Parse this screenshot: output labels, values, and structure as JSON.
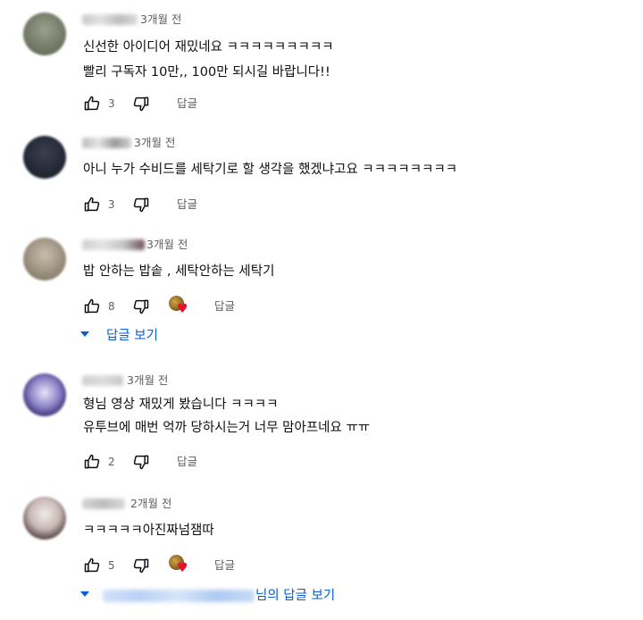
{
  "comments": [
    {
      "time": "3개월 전",
      "lines": [
        "신선한 아이디어 재밌네요 ㅋㅋㅋㅋㅋㅋㅋㅋㅋ",
        "빨리 구독자 10만,, 100만 되시길 바랍니다!!"
      ],
      "likes": "3",
      "reply": "답글"
    },
    {
      "time": "3개월 전",
      "lines": [
        "아니 누가 수비드를 세탁기로 할 생각을 했겠냐고요 ㅋㅋㅋㅋㅋㅋㅋㅋ"
      ],
      "likes": "3",
      "reply": "답글"
    },
    {
      "time": "3개월 전",
      "lines": [
        "밥 안하는 밥솥 , 세탁안하는 세탁기"
      ],
      "likes": "8",
      "reply": "답글",
      "view_replies": "답글 보기"
    },
    {
      "time": "3개월 전",
      "lines": [
        "형님 영상 재밌게 봤습니다 ㅋㅋㅋㅋ",
        "유투브에 매번 억까 당하시는거 너무 맘아프네요 ㅠㅠ"
      ],
      "likes": "2",
      "reply": "답글"
    },
    {
      "time": "2개월 전",
      "lines": [
        "ㅋㅋㅋㅋㅋ아진짜넘잼따"
      ],
      "likes": "5",
      "reply": "답글",
      "view_replies": "님의 답글 보기"
    }
  ],
  "icons": {
    "like": "thumbs-up-icon",
    "dislike": "thumbs-down-icon",
    "expand": "caret-down-icon",
    "creator_heart": "creator-heart-icon"
  },
  "colors": {
    "link": "#065fd4",
    "meta": "#606060",
    "heart": "#e8112d"
  }
}
